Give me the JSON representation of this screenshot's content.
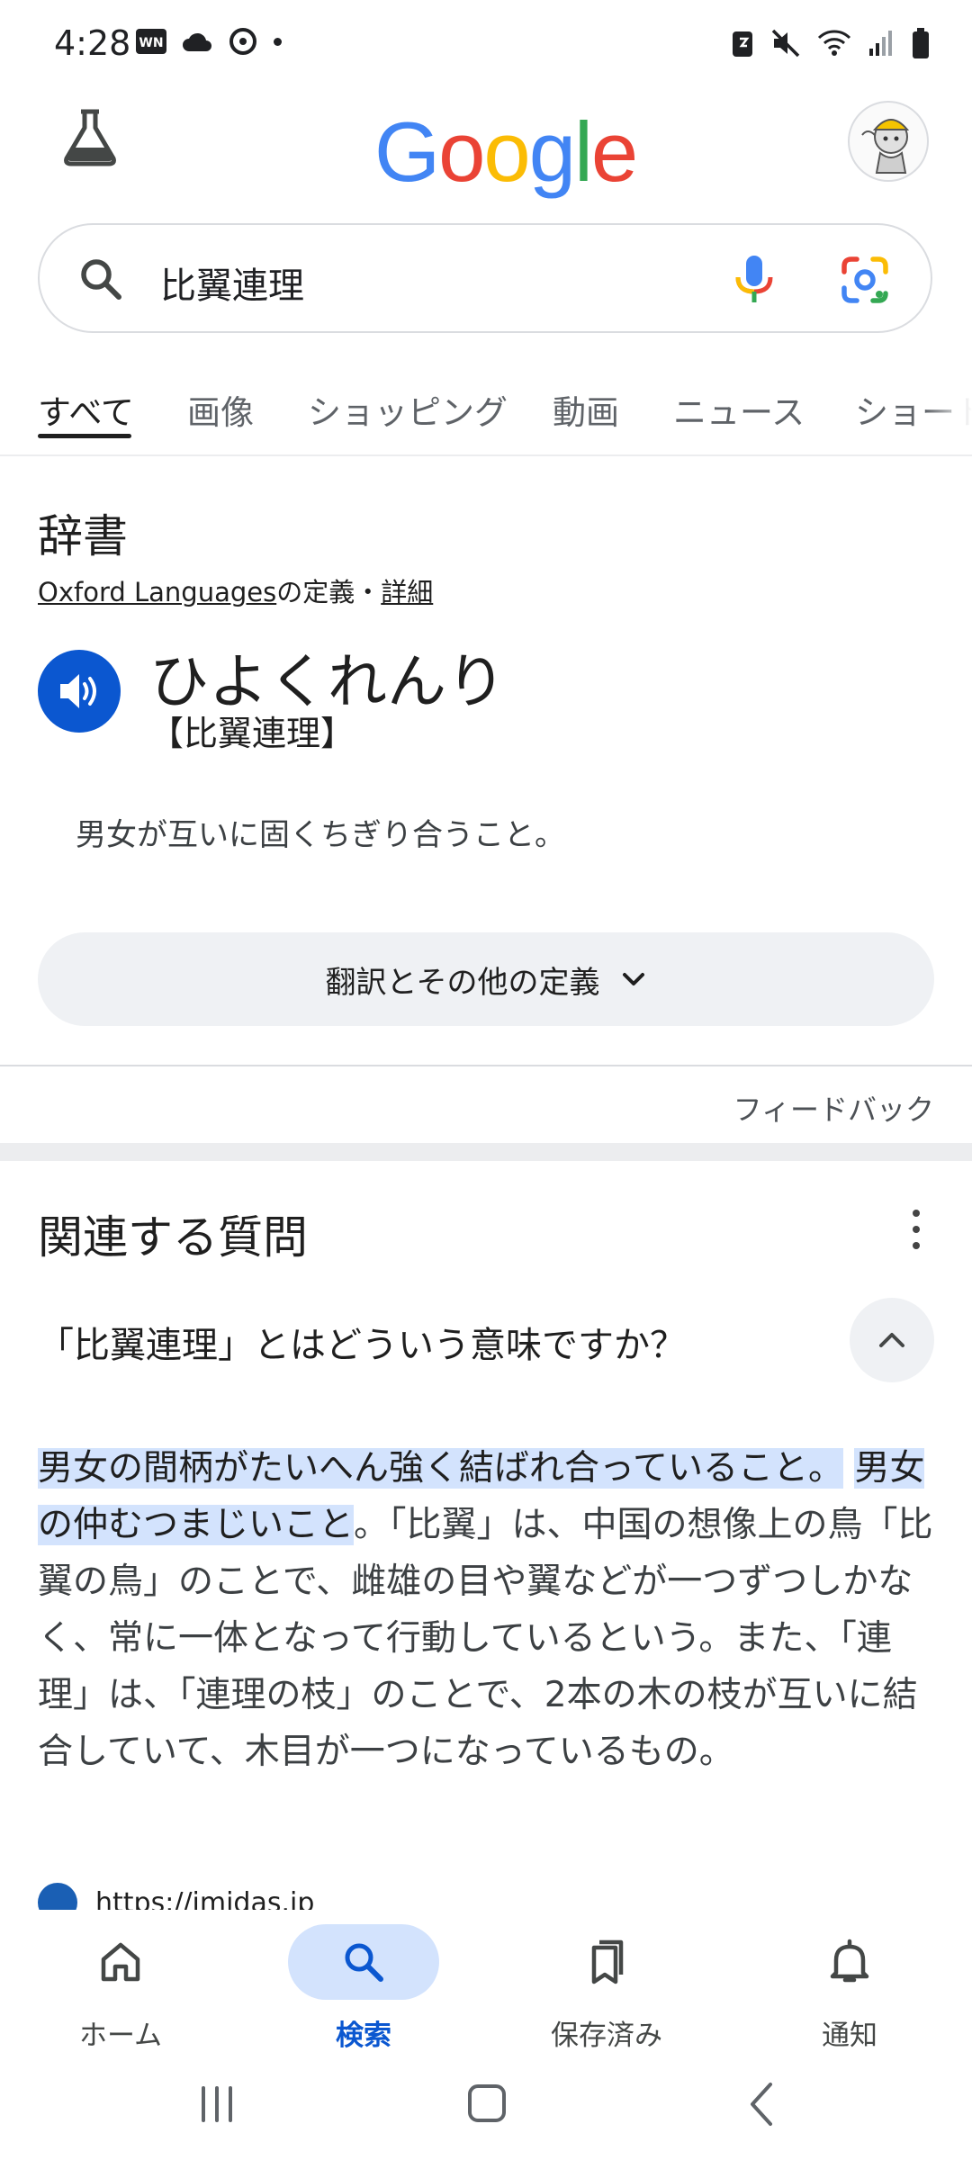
{
  "status_bar": {
    "time": "4:28",
    "left_icons": [
      "news-app-icon",
      "cloud-icon",
      "sync-icon",
      "dot-icon"
    ],
    "right_icons": [
      "battery-saver-icon",
      "mute-icon",
      "wifi-icon",
      "signal-icon",
      "battery-icon"
    ]
  },
  "header": {
    "logo": "Google",
    "icons": {
      "labs": "flask-icon",
      "avatar": "avatar"
    }
  },
  "search": {
    "query": "比翼連理"
  },
  "tabs": [
    {
      "label": "すべて",
      "active": true
    },
    {
      "label": "画像"
    },
    {
      "label": "ショッピング"
    },
    {
      "label": "動画"
    },
    {
      "label": "ニュース"
    },
    {
      "label": "ショート"
    }
  ],
  "dictionary": {
    "heading": "辞書",
    "source_name": "Oxford Languages",
    "source_suffix": "の定義",
    "separator": "・",
    "details_link": "詳細",
    "reading": "ひよくれんり",
    "kanji": "【比翼連理】",
    "definition": "男女が互いに固くちぎり合うこと。",
    "more_button": "翻訳とその他の定義",
    "feedback": "フィードバック"
  },
  "related_questions": {
    "heading": "関連する質問",
    "question": "「比翼連理」とはどういう意味ですか？",
    "answer_highlight_1": "男女の間柄がたいへん強く結ばれ合っていること。",
    "answer_highlight_2": "男女の仲むつまじいこと",
    "answer_rest": "。「比翼」は、中国の想像上の鳥「比翼の鳥」のことで、雌雄の目や翼などが一つずつしかなく、常に一体となって行動しているという。また、「連理」は、「連理の枝」のことで、2本の木の枝が互いに結合していて、木目が一つになっているもの。",
    "source_url": "https://imidas.jp"
  },
  "bottom_nav": [
    {
      "label": "ホーム",
      "icon": "home-icon"
    },
    {
      "label": "検索",
      "icon": "search-icon",
      "active": true
    },
    {
      "label": "保存済み",
      "icon": "bookmarks-icon"
    },
    {
      "label": "通知",
      "icon": "bell-icon"
    }
  ],
  "colors": {
    "accent": "#0b57d0",
    "highlight": "#d3e3fd",
    "google_blue": "#4285F4",
    "google_red": "#EA4335",
    "google_yellow": "#FBBC05",
    "google_green": "#34A853"
  }
}
